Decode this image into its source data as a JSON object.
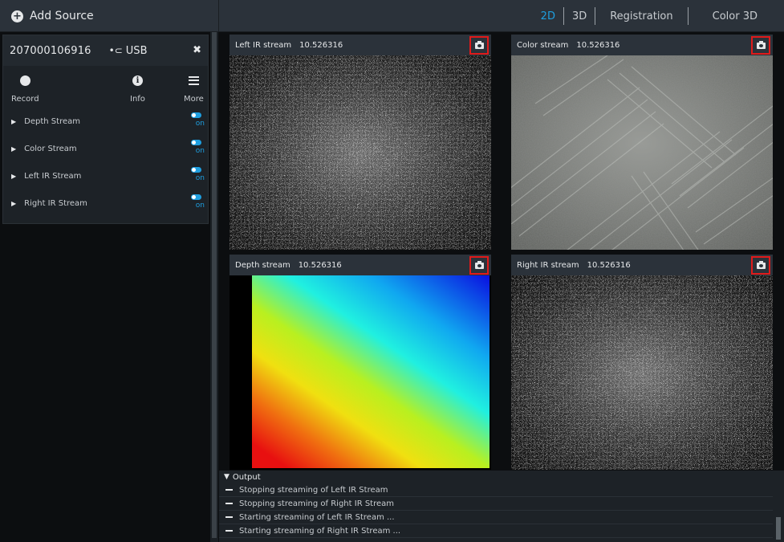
{
  "topbar": {
    "add_source_label": "Add Source",
    "tabs": [
      {
        "label": "2D",
        "active": true
      },
      {
        "label": "3D"
      },
      {
        "label": "Registration"
      },
      {
        "label": "Color 3D"
      }
    ]
  },
  "device": {
    "serial": "207000106916",
    "connection": "USB",
    "actions": [
      {
        "label": "Record",
        "icon": "record-icon"
      },
      {
        "label": "Info",
        "icon": "info-icon"
      },
      {
        "label": "More",
        "icon": "menu-icon"
      }
    ],
    "streams": [
      {
        "label": "Depth Stream",
        "state": "on"
      },
      {
        "label": "Color Stream",
        "state": "on"
      },
      {
        "label": "Left IR Stream",
        "state": "on"
      },
      {
        "label": "Right IR Stream",
        "state": "on"
      }
    ]
  },
  "panels": {
    "left_ir": {
      "title": "Left IR stream",
      "fps": "10.526316"
    },
    "color": {
      "title": "Color stream",
      "fps": "10.526316"
    },
    "depth": {
      "title": "Depth stream",
      "fps": "10.526316"
    },
    "right_ir": {
      "title": "Right IR stream",
      "fps": "10.526316"
    }
  },
  "output": {
    "title": "Output",
    "lines": [
      "Stopping streaming of Left IR Stream",
      "Stopping streaming of Right IR Stream",
      "Starting streaming of Left IR Stream ...",
      "Starting streaming of Right IR Stream ..."
    ]
  },
  "colors": {
    "accent": "#1e9fe0",
    "highlight_border": "#e01a1a",
    "panel_header": "#2b323a"
  }
}
